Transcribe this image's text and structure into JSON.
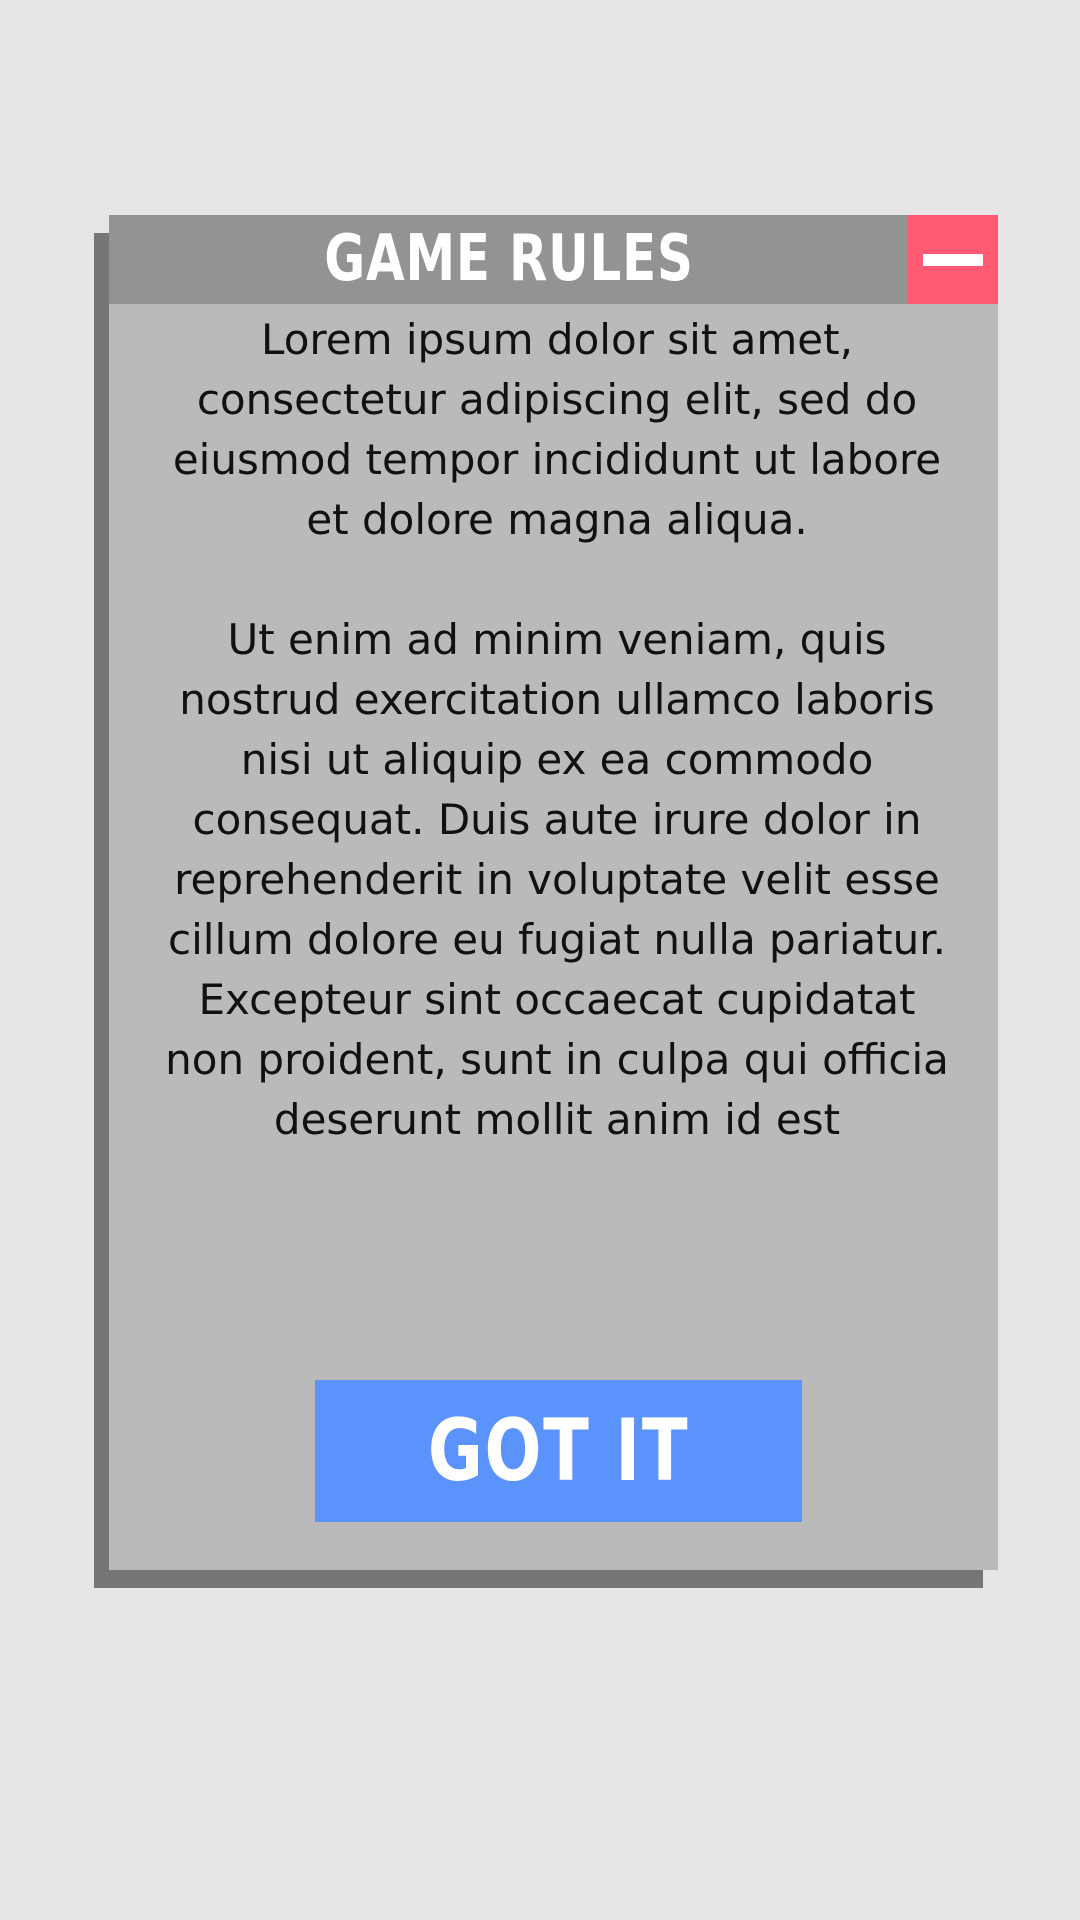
{
  "dialog": {
    "title": "GAME RULES",
    "minimize_icon": "minus-icon",
    "paragraphs": [
      "Lorem ipsum dolor sit amet, consectetur adipiscing elit, sed do eiusmod tempor incididunt ut labore et dolore magna aliqua.",
      "Ut enim ad minim veniam, quis nostrud exercitation ullamco laboris nisi ut aliquip ex ea commodo consequat. Duis aute irure dolor in reprehenderit in voluptate velit esse cillum dolore eu fugiat nulla pariatur. Excepteur sint occaecat cupidatat non proident, sunt in culpa qui officia deserunt mollit anim id est"
    ],
    "confirm_label": "GOT IT"
  },
  "colors": {
    "background": "#e6e6e7",
    "dialog_body": "#bababa",
    "dialog_header": "#939393",
    "dialog_shadow": "#767676",
    "minimize_button": "#ff5a71",
    "confirm_button": "#5b93fd",
    "text": "#111111",
    "header_text": "#ffffff"
  }
}
